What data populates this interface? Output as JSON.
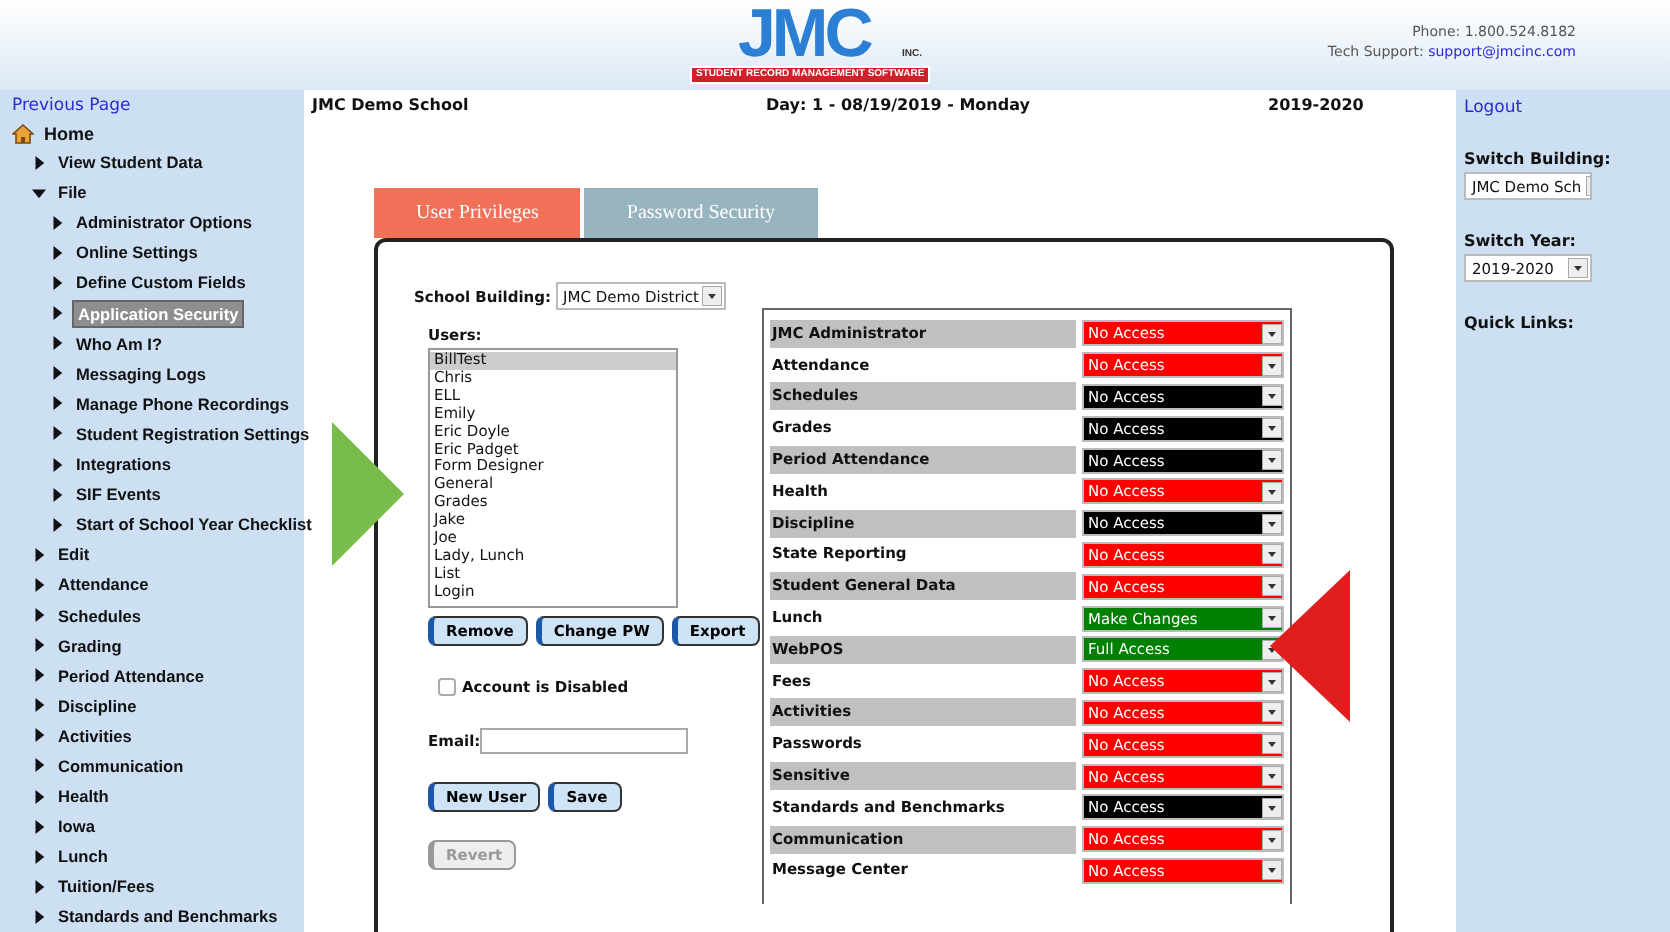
{
  "header": {
    "logo": {
      "wordmark": "JMC",
      "banner": "STUDENT RECORD MANAGEMENT SOFTWARE",
      "suffix": "INC."
    },
    "phone": "Phone: 1.800.524.8182",
    "support_label": "Tech Support:",
    "support_email": "support@jmcinc.com"
  },
  "left_nav": {
    "previous_link": "Previous Page",
    "home": "Home",
    "items": [
      {
        "label": "View Student Data",
        "expanded": false,
        "selected": false
      },
      {
        "label": "File",
        "expanded": true,
        "selected": false,
        "children": [
          {
            "label": "Administrator Options",
            "expanded": false,
            "selected": false
          },
          {
            "label": "Online Settings",
            "expanded": false,
            "selected": false
          },
          {
            "label": "Define Custom Fields",
            "expanded": false,
            "selected": false
          },
          {
            "label": "Application Security",
            "expanded": false,
            "selected": true
          },
          {
            "label": "Who Am I?",
            "expanded": false,
            "selected": false
          },
          {
            "label": "Messaging Logs",
            "expanded": false,
            "selected": false
          },
          {
            "label": "Manage Phone Recordings",
            "expanded": false,
            "selected": false
          },
          {
            "label": "Student Registration Settings",
            "expanded": false,
            "selected": false
          },
          {
            "label": "Integrations",
            "expanded": false,
            "selected": false
          },
          {
            "label": "SIF Events",
            "expanded": false,
            "selected": false
          },
          {
            "label": "Start of School Year Checklist",
            "expanded": false,
            "selected": false
          }
        ]
      },
      {
        "label": "Edit",
        "expanded": false,
        "selected": false
      },
      {
        "label": "Attendance",
        "expanded": false,
        "selected": false
      },
      {
        "label": "Schedules",
        "expanded": false,
        "selected": false
      },
      {
        "label": "Grading",
        "expanded": false,
        "selected": false
      },
      {
        "label": "Period Attendance",
        "expanded": false,
        "selected": false
      },
      {
        "label": "Discipline",
        "expanded": false,
        "selected": false
      },
      {
        "label": "Activities",
        "expanded": false,
        "selected": false
      },
      {
        "label": "Communication",
        "expanded": false,
        "selected": false
      },
      {
        "label": "Health",
        "expanded": false,
        "selected": false
      },
      {
        "label": "Iowa",
        "expanded": false,
        "selected": false
      },
      {
        "label": "Lunch",
        "expanded": false,
        "selected": false
      },
      {
        "label": "Tuition/Fees",
        "expanded": false,
        "selected": false
      },
      {
        "label": "Standards and Benchmarks",
        "expanded": false,
        "selected": false
      }
    ]
  },
  "top_bar": {
    "school": "JMC Demo School",
    "day": "Day: 1 - 08/19/2019 - Monday",
    "year": "2019-2020"
  },
  "tabs": [
    {
      "label": "User Privileges",
      "selected": true
    },
    {
      "label": "Password Security",
      "selected": false
    }
  ],
  "school_building": {
    "label": "School Building:",
    "value": "JMC Demo District"
  },
  "users": {
    "label": "Users:",
    "items": [
      {
        "name": "BillTest",
        "selected": true
      },
      {
        "name": "Chris",
        "selected": false
      },
      {
        "name": "ELL",
        "selected": false
      },
      {
        "name": "Emily",
        "selected": false
      },
      {
        "name": "Eric Doyle",
        "selected": false
      },
      {
        "name": "Eric Padget",
        "selected": false
      },
      {
        "name": "Form Designer",
        "selected": false
      },
      {
        "name": "General",
        "selected": false
      },
      {
        "name": "Grades",
        "selected": false
      },
      {
        "name": "Jake",
        "selected": false
      },
      {
        "name": "Joe",
        "selected": false
      },
      {
        "name": "Lady, Lunch",
        "selected": false
      },
      {
        "name": "List",
        "selected": false
      },
      {
        "name": "Login",
        "selected": false
      }
    ]
  },
  "user_buttons": [
    {
      "label": "Remove",
      "disabled": false
    },
    {
      "label": "Change PW",
      "disabled": false
    },
    {
      "label": "Export",
      "disabled": false
    }
  ],
  "account_disabled": {
    "label": "Account is Disabled",
    "checked": false
  },
  "email": {
    "label": "Email:"
  },
  "save_buttons": [
    {
      "label": "New User",
      "disabled": false
    },
    {
      "label": "Save",
      "disabled": false
    }
  ],
  "revert_button": {
    "label": "Revert",
    "disabled": true
  },
  "privileges": [
    {
      "name": "JMC Administrator",
      "value": "No Access",
      "color": "#ff0000"
    },
    {
      "name": "Attendance",
      "value": "No Access",
      "color": "#ff0000"
    },
    {
      "name": "Schedules",
      "value": "No Access",
      "color": "#000000"
    },
    {
      "name": "Grades",
      "value": "No Access",
      "color": "#000000"
    },
    {
      "name": "Period Attendance",
      "value": "No Access",
      "color": "#000000"
    },
    {
      "name": "Health",
      "value": "No Access",
      "color": "#ff0000"
    },
    {
      "name": "Discipline",
      "value": "No Access",
      "color": "#000000"
    },
    {
      "name": "State Reporting",
      "value": "No Access",
      "color": "#ff0000"
    },
    {
      "name": "Student General Data",
      "value": "No Access",
      "color": "#ff0000"
    },
    {
      "name": "Lunch",
      "value": "Make Changes",
      "color": "#008000"
    },
    {
      "name": "WebPOS",
      "value": "Full Access",
      "color": "#008000"
    },
    {
      "name": "Fees",
      "value": "No Access",
      "color": "#ff0000"
    },
    {
      "name": "Activities",
      "value": "No Access",
      "color": "#ff0000"
    },
    {
      "name": "Passwords",
      "value": "No Access",
      "color": "#ff0000"
    },
    {
      "name": "Sensitive",
      "value": "No Access",
      "color": "#ff0000"
    },
    {
      "name": "Standards and Benchmarks",
      "value": "No Access",
      "color": "#000000"
    },
    {
      "name": "Communication",
      "value": "No Access",
      "color": "#ff0000"
    },
    {
      "name": "Message Center",
      "value": "No Access",
      "color": "#ff0000"
    }
  ],
  "right_sidebar": {
    "logout": "Logout",
    "switch_building": {
      "label": "Switch Building:",
      "value": "JMC Demo Sch"
    },
    "switch_year": {
      "label": "Switch Year:",
      "value": "2019-2020"
    },
    "quick_links": "Quick Links:"
  }
}
